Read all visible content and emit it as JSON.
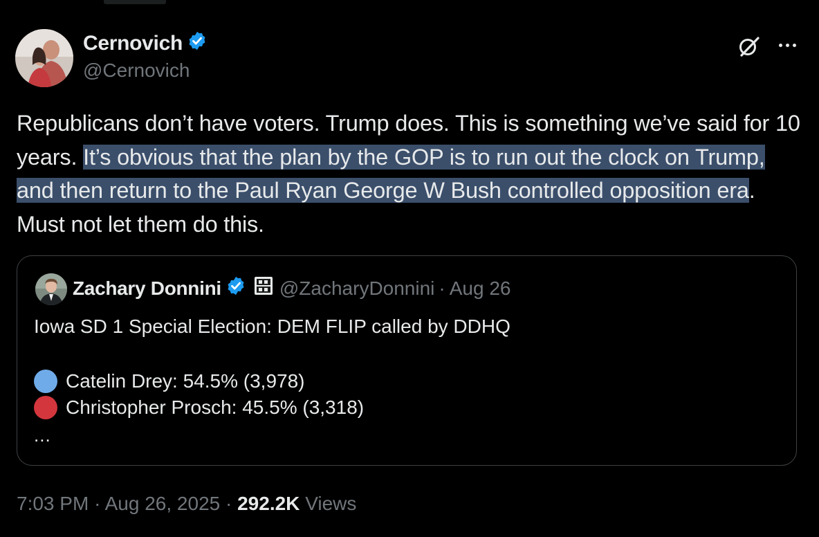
{
  "tweet": {
    "author": {
      "name": "Cernovich",
      "handle": "@Cernovich",
      "verified_color": "#1d9bf0"
    },
    "text_before_highlight": "Republicans don’t have voters. Trump does. This is something we’ve said for 10 years. ",
    "text_highlighted": "It’s obvious that the plan by the GOP is to run out the clock on Trump, and then return to the Paul Ryan George W Bush controlled opposition era",
    "text_after_highlight": ". Must not let them do this.",
    "highlight_color": "#3b4f6b",
    "timestamp_time": "7:03 PM",
    "separator": "·",
    "timestamp_date": "Aug 26, 2025",
    "views_count": "292.2K",
    "views_label": "Views"
  },
  "quote": {
    "author_name": "Zachary Donnini",
    "handle": "@ZacharyDonnini",
    "separator": "·",
    "date": "Aug 26",
    "badge_icon": "ddhq-logo-icon",
    "line1": "Iowa SD 1 Special Election: DEM FLIP called by DDHQ",
    "results": [
      {
        "color": "#6fabe8",
        "text": "Catelin Drey: 54.5% (3,978)"
      },
      {
        "color": "#d4363e",
        "text": "Christopher Prosch: 45.5% (3,318)"
      }
    ],
    "ellipsis": "..."
  },
  "icons": {
    "grok": "grok-icon",
    "more": "more-options-icon",
    "verified": "verified-badge-icon"
  }
}
